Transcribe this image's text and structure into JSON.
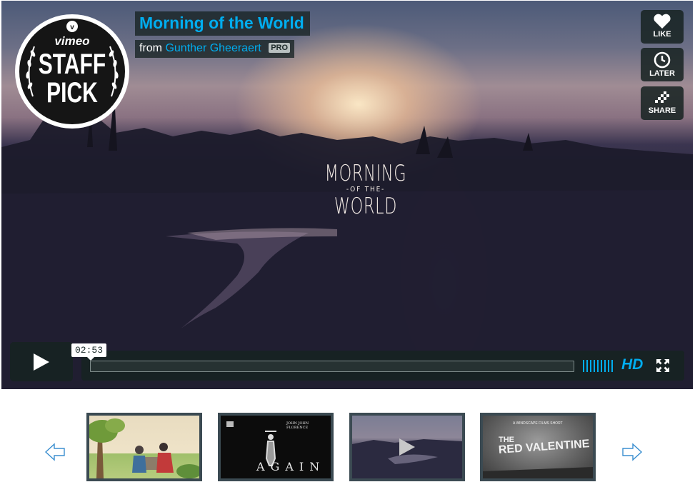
{
  "video": {
    "title": "Morning of the World",
    "byline_from": "from",
    "author": "Gunther Gheeraert",
    "pro_badge": "PRO",
    "title_card": {
      "line1": "MORNING",
      "line2": "-OF THE-",
      "line3": "WORLD"
    },
    "staff_pick": {
      "brand": "vimeo",
      "line1": "STAFF",
      "line2": "PICK"
    }
  },
  "actions": [
    {
      "label": "LIKE",
      "icon": "heart-icon"
    },
    {
      "label": "LATER",
      "icon": "clock-icon"
    },
    {
      "label": "SHARE",
      "icon": "share-icon"
    }
  ],
  "controls": {
    "timestamp": "02:53",
    "hd_label": "HD",
    "progress": 0,
    "volume_bars": 9,
    "icons": [
      "play-icon",
      "fullscreen-icon"
    ]
  },
  "carousel": {
    "thumbs": [
      {
        "id": "thumb-1",
        "text": ""
      },
      {
        "id": "thumb-2",
        "text_top": "JOHN JOHN FLORENCE",
        "text_main": "AGAIN"
      },
      {
        "id": "thumb-3",
        "text": ""
      },
      {
        "id": "thumb-4",
        "text_top": "A WINDSCAPE FILMS SHORT",
        "text_main1": "THE",
        "text_main2": "RED VALENTINE"
      }
    ],
    "icons": [
      "arrow-left-icon",
      "arrow-right-icon"
    ]
  },
  "colors": {
    "accent": "#00adef",
    "overlay": "#172322"
  }
}
